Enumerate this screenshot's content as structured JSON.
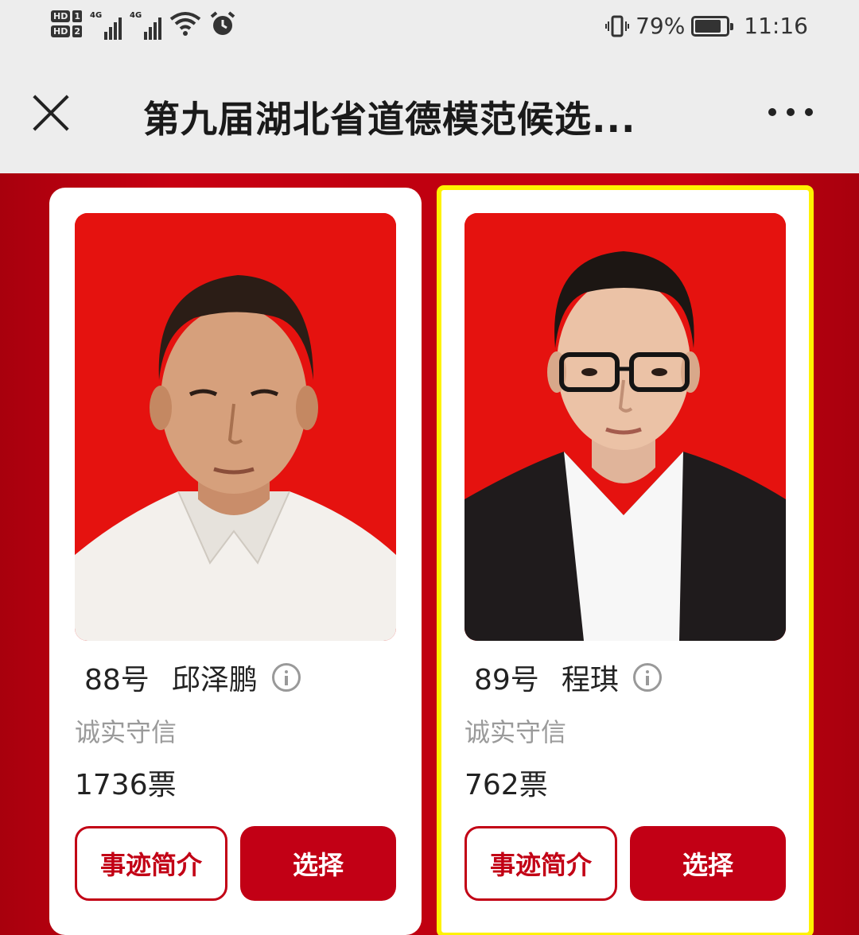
{
  "status_bar": {
    "hd1": "HD",
    "hd1_num": "1",
    "hd2": "HD",
    "hd2_num": "2",
    "sig1_tag": "4G",
    "sig2_tag": "4G",
    "battery_percent": "79%",
    "battery_level": 0.79,
    "time": "11:16",
    "icons": [
      "wifi-icon",
      "alarm-icon",
      "vibrate-icon",
      "battery-icon"
    ]
  },
  "header": {
    "title": "第九届湖北省道德模范候选..."
  },
  "candidates": [
    {
      "number": "88号",
      "name": "邱泽鹏",
      "trait": "诚实守信",
      "votes": "1736票",
      "detail_label": "事迹简介",
      "select_label": "选择",
      "selected": false
    },
    {
      "number": "89号",
      "name": "程琪",
      "trait": "诚实守信",
      "votes": "762票",
      "detail_label": "事迹简介",
      "select_label": "选择",
      "selected": true
    }
  ],
  "colors": {
    "brand_red": "#c20015",
    "background_red": "#b8000f",
    "highlight": "#fff200"
  }
}
